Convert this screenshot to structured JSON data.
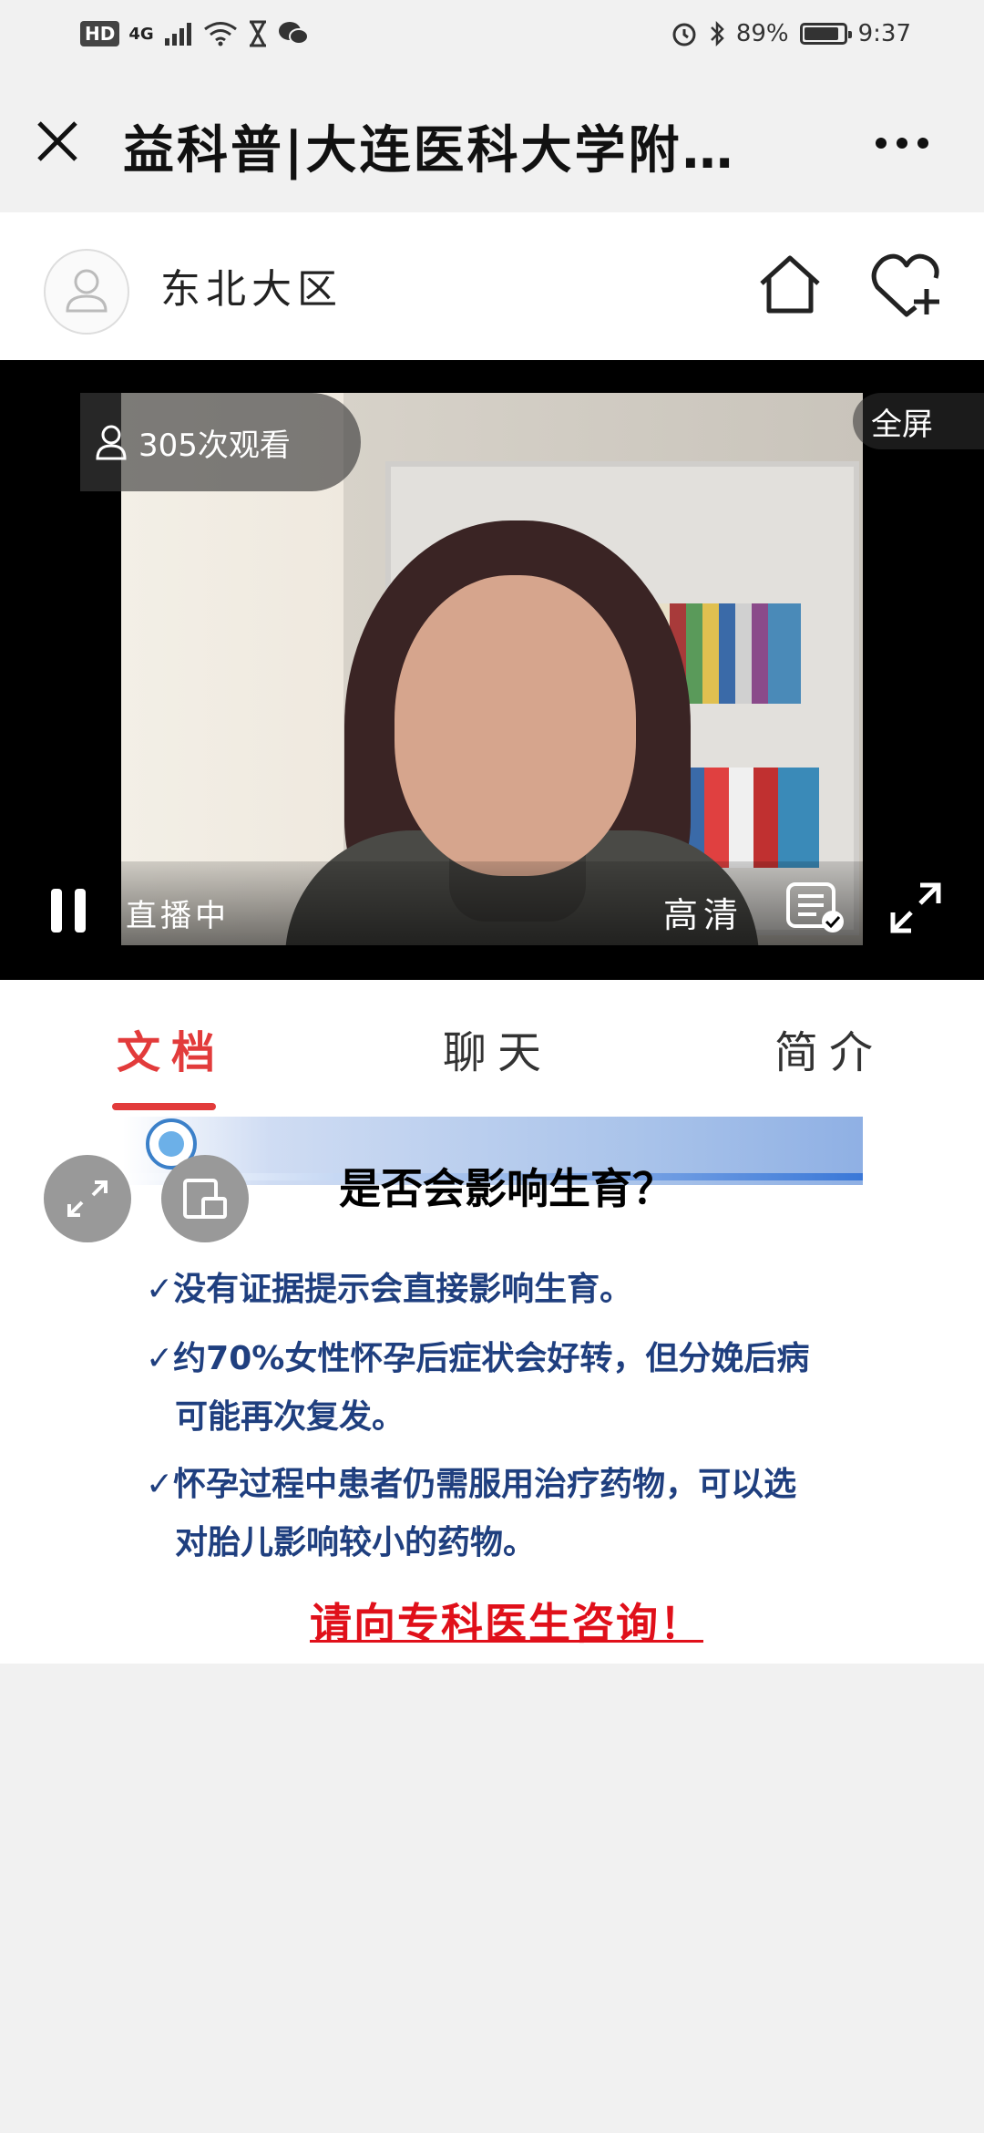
{
  "status_bar": {
    "hd": "HD",
    "network": "4G",
    "battery_percent": "89%",
    "battery_level": 0.89,
    "time": "9:37",
    "icons": [
      "hd-icon",
      "signal-icon",
      "wifi-icon",
      "hourglass-icon",
      "wechat-icon",
      "alarm-icon",
      "bluetooth-icon",
      "battery-icon"
    ]
  },
  "header": {
    "title": "益科普|大连医科大学附…",
    "close_icon": "close-icon",
    "more_icon": "more-icon"
  },
  "channel": {
    "name": "东北大区",
    "avatar_icon": "avatar-icon",
    "home_icon": "home-icon",
    "favorite_icon": "heart-plus-icon"
  },
  "video": {
    "viewers": "305次观看",
    "fullscreen_label": "全屏",
    "live_label": "直播中",
    "quality_label": "高清",
    "danmaku_icon": "danmaku-icon",
    "pause_icon": "pause-icon",
    "expand_icon": "expand-icon"
  },
  "tabs": [
    {
      "label": "文档",
      "active": true
    },
    {
      "label": "聊天",
      "active": false
    },
    {
      "label": "简介",
      "active": false
    }
  ],
  "document": {
    "slide_title": "是否会影响生育？",
    "bullets": [
      "✓没有证据提示会直接影响生育。",
      "✓约70%女性怀孕后症状会好转，但分娩后病",
      "可能再次复发。",
      "✓怀孕过程中患者仍需服用治疗药物，可以选",
      "对胎儿影响较小的药物。"
    ],
    "consult": "请向专科医生咨询！"
  },
  "colors": {
    "accent": "#e23b3b",
    "slide_text": "#1f3f7f",
    "consult_text": "#e0101a"
  }
}
